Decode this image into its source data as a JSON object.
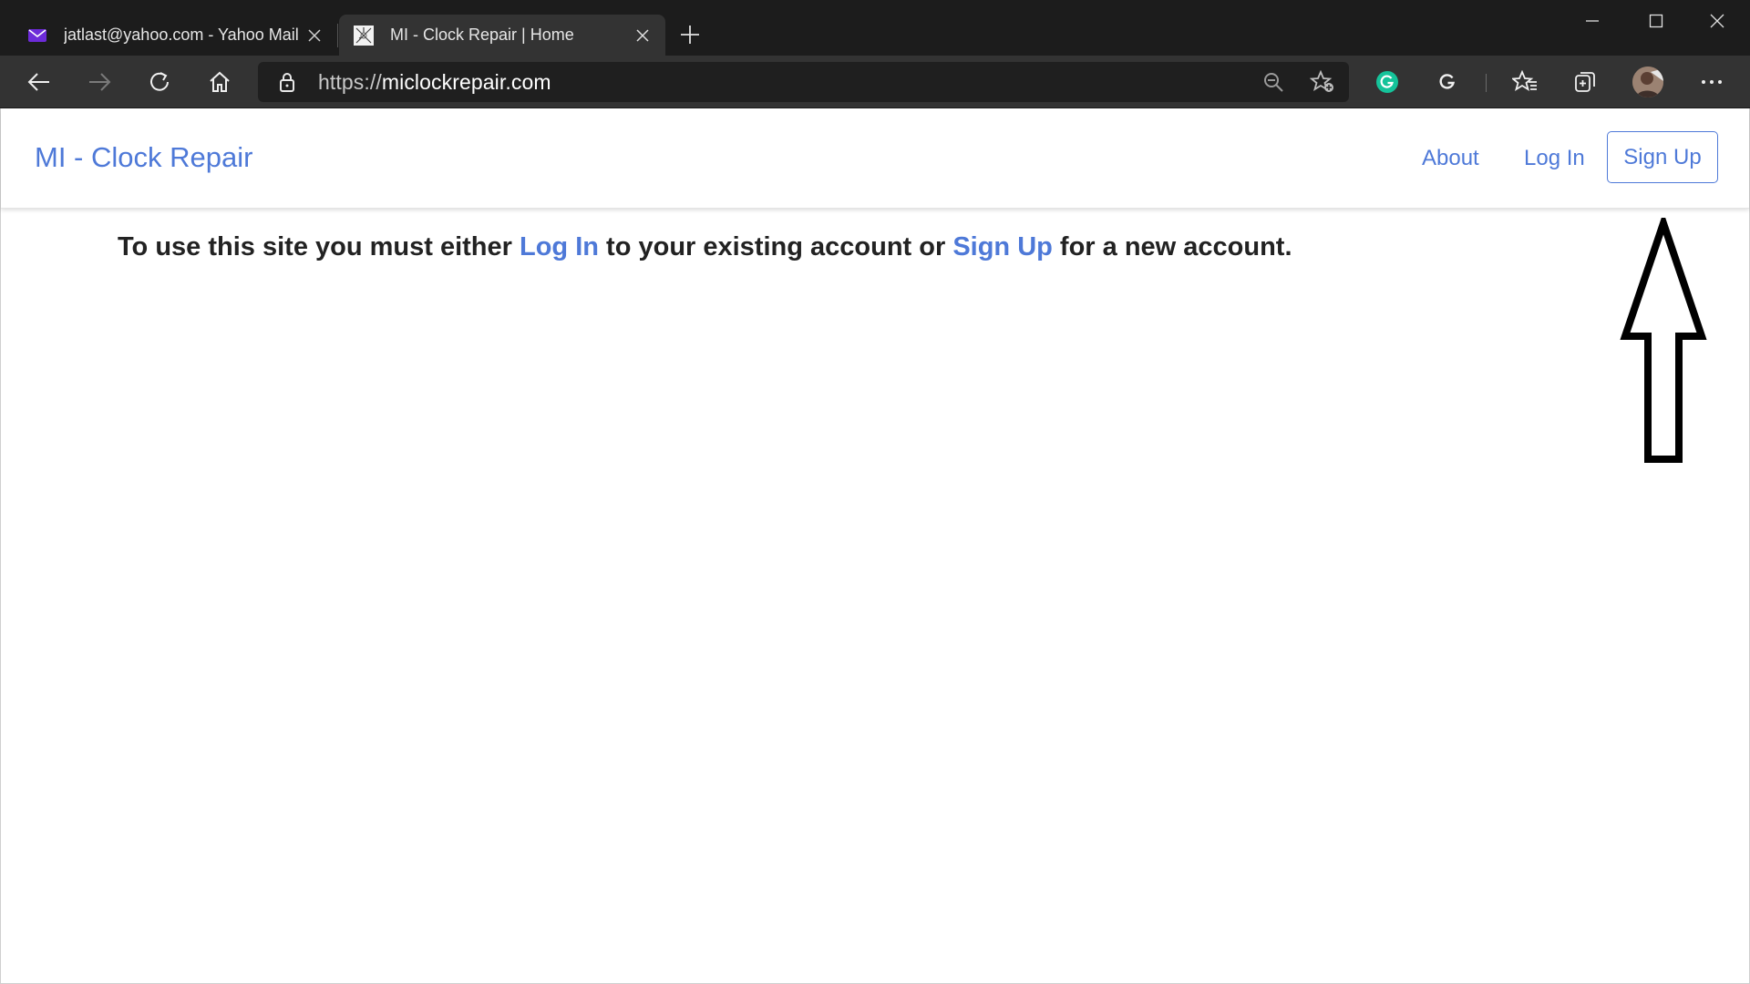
{
  "browser": {
    "tabs": [
      {
        "title": "jatlast@yahoo.com - Yahoo Mail",
        "favicon": "yahoo-mail-icon",
        "active": false
      },
      {
        "title": "MI - Clock Repair | Home",
        "favicon": "clock-site-icon",
        "active": true
      }
    ],
    "address_bar": {
      "url_scheme": "https://",
      "url_host": "miclockrepair.com"
    }
  },
  "site": {
    "brand": "MI - Clock Repair",
    "nav": {
      "about": "About",
      "login": "Log In",
      "signup": "Sign Up"
    },
    "message": {
      "prefix": "To use this site you must either ",
      "login_link": "Log In",
      "middle": " to your existing account or ",
      "signup_link": "Sign Up",
      "suffix": " for a new account."
    }
  },
  "colors": {
    "link": "#4e79d8",
    "chrome_dark": "#1c1c1c",
    "toolbar": "#333333",
    "grammarly": "#15c39a"
  }
}
